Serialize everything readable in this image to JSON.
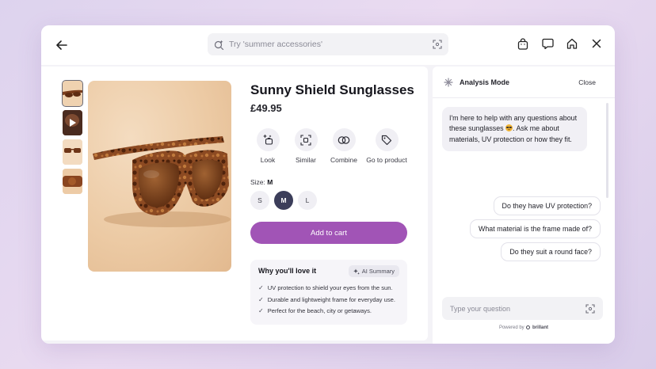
{
  "search": {
    "placeholder": "Try 'summer accessories'"
  },
  "product": {
    "title": "Sunny Shield Sunglasses",
    "price": "£49.95",
    "actions": [
      {
        "label": "Look",
        "icon": "look-icon"
      },
      {
        "label": "Similar",
        "icon": "similar-icon"
      },
      {
        "label": "Combine",
        "icon": "combine-icon"
      },
      {
        "label": "Go to product",
        "icon": "tag-icon"
      }
    ],
    "size_prefix": "Size:",
    "size_selected": "M",
    "sizes": [
      "S",
      "M",
      "L"
    ],
    "add_to_cart": "Add to cart"
  },
  "why": {
    "title": "Why you'll love it",
    "badge": "AI Summary",
    "items": [
      "UV protection to shield your eyes from the sun.",
      "Durable and lightweight frame for everyday use.",
      "Perfect for the beach, city or getaways."
    ]
  },
  "assistant": {
    "title": "Analysis Mode",
    "close": "Close",
    "message_part1": "I'm here to help with any questions about these sunglasses",
    "message_part2": ". Ask me about materials, UV protection or how they fit.",
    "suggestions": [
      "Do they have UV protection?",
      "What material is the frame made of?",
      "Do they suit a round face?"
    ],
    "input_placeholder": "Type your question",
    "powered_by": "Powered by",
    "brand": "brillant"
  },
  "colors": {
    "accent": "#a154b6",
    "selected_size": "#3c3e5a",
    "tortoise": "#7a3d1c"
  }
}
